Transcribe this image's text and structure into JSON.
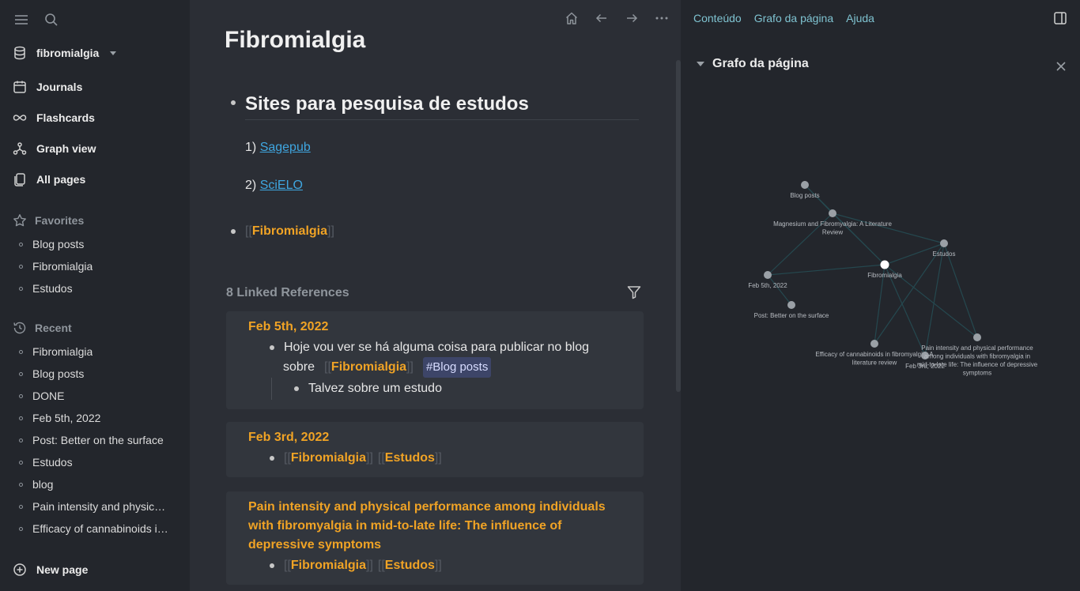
{
  "sidebar": {
    "graph_name": "fibromialgia",
    "nav": [
      {
        "label": "Journals"
      },
      {
        "label": "Flashcards"
      },
      {
        "label": "Graph view"
      },
      {
        "label": "All pages"
      }
    ],
    "favorites_title": "Favorites",
    "favorites": [
      "Blog posts",
      "Fibromialgia",
      "Estudos"
    ],
    "recent_title": "Recent",
    "recent": [
      "Fibromialgia",
      "Blog posts",
      "DONE",
      "Feb 5th, 2022",
      "Post: Better on the surface",
      "Estudos",
      "blog",
      "Pain intensity and physic…",
      "Efficacy of cannabinoids i…"
    ],
    "new_page": "New page"
  },
  "main": {
    "title": "Fibromialgia",
    "heading": "Sites para pesquisa de estudos",
    "list": [
      {
        "num": "1)",
        "link": "Sagepub"
      },
      {
        "num": "2)",
        "link": "SciELO"
      }
    ],
    "page_ref": "Fibromialgia",
    "linked_refs_title": "8 Linked References",
    "cards": [
      {
        "title": "Feb 5th, 2022",
        "line1": "Hoje vou ver se há alguma coisa para publicar no blog",
        "line2_prefix": "sobre",
        "line2_ref": "Fibromialgia",
        "tag": "#Blog posts",
        "child": "Talvez sobre um estudo"
      },
      {
        "title": "Feb 3rd, 2022",
        "ref1": "Fibromialgia",
        "ref2": "Estudos"
      },
      {
        "title_l1": "Pain intensity and physical performance among individuals",
        "title_l2": "with fibromyalgia in mid-to-late life: The influence of",
        "title_l3": "depressive symptoms",
        "ref1": "Fibromialgia",
        "ref2": "Estudos"
      }
    ]
  },
  "right": {
    "tabs": [
      "Conteúdo",
      "Grafo da página",
      "Ajuda"
    ],
    "panel_title": "Grafo da página",
    "graph_nodes": [
      {
        "id": "blog",
        "label_lines": [
          "Blog posts"
        ]
      },
      {
        "id": "mag",
        "label_lines": [
          "Magnesium and Fibromyalgia: A Literature",
          "Review"
        ]
      },
      {
        "id": "est",
        "label_lines": [
          "Estudos"
        ]
      },
      {
        "id": "fib",
        "label_lines": [
          "Fibromialgia"
        ]
      },
      {
        "id": "f5",
        "label_lines": [
          "Feb 5th, 2022"
        ]
      },
      {
        "id": "post",
        "label_lines": [
          "Post: Better on the surface"
        ]
      },
      {
        "id": "eff",
        "label_lines": [
          "Efficacy of cannabinoids in fibromyalgia: A",
          "literature review"
        ]
      },
      {
        "id": "f3",
        "label_lines": [
          "Feb 3rd, 2022"
        ]
      },
      {
        "id": "pain",
        "label_lines": [
          "Pain intensity and physical performance",
          "among individuals with fibromyalgia in",
          "mid-to-late life: The influence of depressive",
          "symptoms"
        ]
      }
    ],
    "graph_edges": [
      [
        "fib",
        "blog"
      ],
      [
        "fib",
        "mag"
      ],
      [
        "fib",
        "est"
      ],
      [
        "fib",
        "f5"
      ],
      [
        "fib",
        "eff"
      ],
      [
        "fib",
        "f3"
      ],
      [
        "fib",
        "pain"
      ],
      [
        "est",
        "eff"
      ],
      [
        "est",
        "f3"
      ],
      [
        "est",
        "pain"
      ],
      [
        "mag",
        "est"
      ],
      [
        "mag",
        "f5"
      ],
      [
        "blog",
        "mag"
      ],
      [
        "post",
        "f5"
      ]
    ],
    "colors": {
      "active_node": "#ffffff",
      "node": "#9aa0a6",
      "edge": "#25484f"
    }
  },
  "icons": [
    "menu-icon",
    "search-icon",
    "database-icon",
    "calendar-icon",
    "infinity-icon",
    "graph-icon",
    "pages-icon",
    "star-icon",
    "history-icon",
    "plus-circle-icon",
    "home-icon",
    "arrow-left-icon",
    "arrow-right-icon",
    "more-icon",
    "filter-icon",
    "sidebar-toggle-icon",
    "close-icon"
  ]
}
